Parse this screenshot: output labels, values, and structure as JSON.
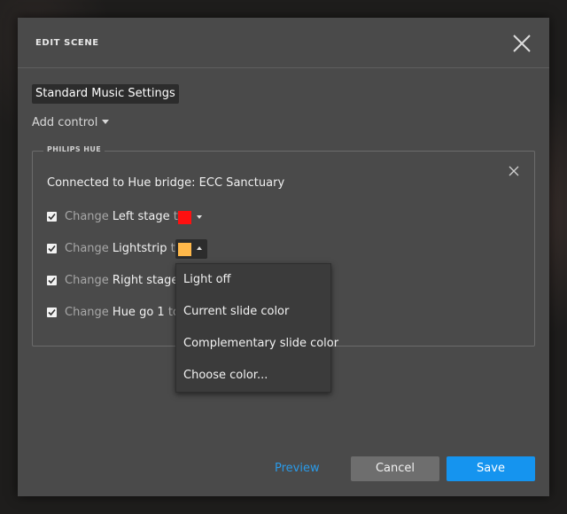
{
  "modal": {
    "title": "EDIT SCENE",
    "scene_name": "Standard Music Settings",
    "add_control_label": "Add control"
  },
  "hue_section": {
    "legend": "PHILIPS HUE",
    "bridge_text": "Connected to Hue bridge: ECC Sanctuary",
    "rows": [
      {
        "checked": true,
        "prefix": "Change",
        "target": "Left stage",
        "suffix": "to",
        "color": "#ff1010"
      },
      {
        "checked": true,
        "prefix": "Change",
        "target": "Lightstrip",
        "suffix": "to",
        "color": "#ffb84a"
      },
      {
        "checked": true,
        "prefix": "Change",
        "target": "Right stage",
        "suffix": "to",
        "color": ""
      },
      {
        "checked": true,
        "prefix": "Change",
        "target": "Hue go 1",
        "suffix": "to",
        "color": ""
      }
    ]
  },
  "color_menu": {
    "items": [
      "Light off",
      "Current slide color",
      "Complementary slide color",
      "Choose color..."
    ]
  },
  "footer": {
    "preview_label": "Preview",
    "cancel_label": "Cancel",
    "save_label": "Save"
  },
  "colors": {
    "accent": "#1594ef",
    "modal_bg": "#4a4a4a"
  }
}
